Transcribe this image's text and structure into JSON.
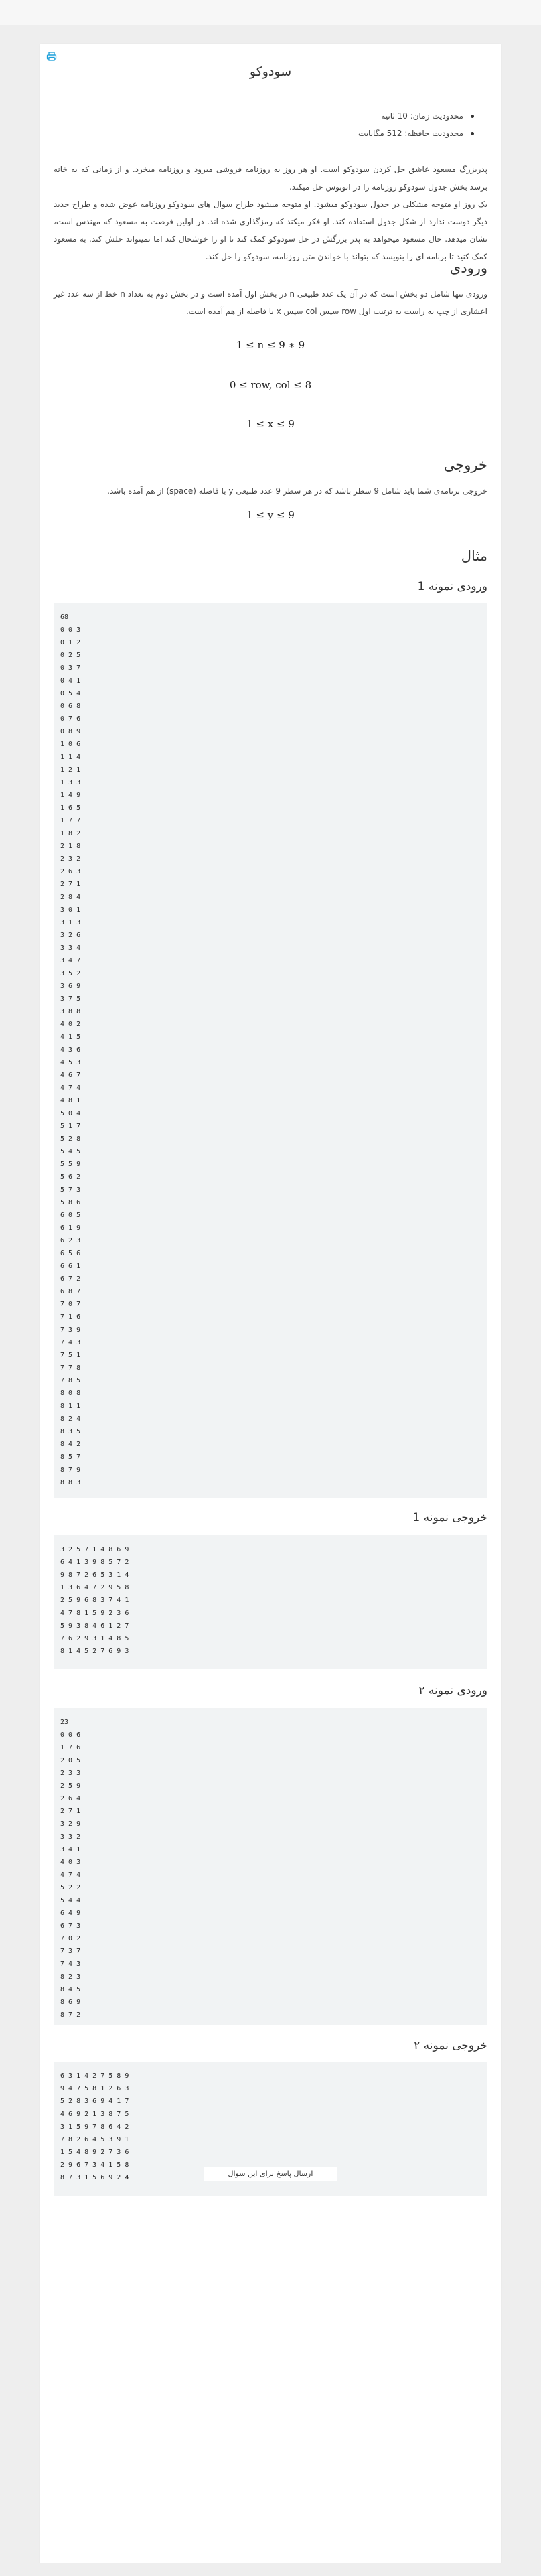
{
  "problem": {
    "title": "سودوکو",
    "limits": [
      "محدودیت زمان: 10 ثانیه",
      "محدودیت حافظه: 512 مگابایت"
    ],
    "statement": [
      "پدربزرگ مسعود عاشق حل کردن سودوکو است. او هر روز به روزنامه فروشی میرود و روزنامه میخرد. و از زمانی که به خانه برسد بخش جدول سودوکو روزنامه را در اتوبوس حل میکند.",
      "یک روز او متوجه مشکلی در جدول سودوکو میشود. او متوجه میشود طراح سوال های سودوکو روزنامه عوض شده و طراح جدید دیگر دوست ندارد از شکل جدول استفاده کند. او فکر میکند که رمزگذاری شده اند. در اولین فرصت به مسعود که مهندس است، نشان میدهد. حال مسعود میخواهد به پدر بزرگش در حل سودوکو کمک کند تا او را خوشحال کند اما نمیتواند حلش کند. به مسعود کمک کنید تا برنامه ای را بنویسد که بتواند با خواندن متن روزنامه، سودوکو را حل کند."
    ],
    "input_heading": "ورودی",
    "input_text": "ورودی تنها شامل دو بخش است که در آن یک عدد طبیعی n در بخش اول آمده است و در بخش دوم به تعداد n خط از سه عدد غیر اعشاری از چپ به راست به ترتیب اول row سپس col سپس x با فاصله از هم آمده است.",
    "input_math": [
      "1 ≤ n ≤ 9 ∗ 9",
      "0 ≤ row, col ≤ 8",
      "1 ≤ x ≤ 9"
    ],
    "output_heading": "خروجی",
    "output_text": "خروجی برنامه‌ی شما باید شامل 9 سطر باشد که در هر سطر 9 عدد طبیعی y با فاصله (space) از هم آمده باشد.",
    "output_math": "1 ≤ y ≤ 9",
    "example_heading": "مثال",
    "samples": [
      {
        "heading": "ورودی نمونه 1",
        "lines": [
          "68",
          "0 0 3",
          "0 1 2",
          "0 2 5",
          "0 3 7",
          "0 4 1",
          "0 5 4",
          "0 6 8",
          "0 7 6",
          "0 8 9",
          "1 0 6",
          "1 1 4",
          "1 2 1",
          "1 3 3",
          "1 4 9",
          "1 6 5",
          "1 7 7",
          "1 8 2",
          "2 1 8",
          "2 3 2",
          "2 6 3",
          "2 7 1",
          "2 8 4",
          "3 0 1",
          "3 1 3",
          "3 2 6",
          "3 3 4",
          "3 4 7",
          "3 5 2",
          "3 6 9",
          "3 7 5",
          "3 8 8",
          "4 0 2",
          "4 1 5",
          "4 3 6",
          "4 5 3",
          "4 6 7",
          "4 7 4",
          "4 8 1",
          "5 0 4",
          "5 1 7",
          "5 2 8",
          "5 4 5",
          "5 5 9",
          "5 6 2",
          "5 7 3",
          "5 8 6",
          "6 0 5",
          "6 1 9",
          "6 2 3",
          "6 5 6",
          "6 6 1",
          "6 7 2",
          "6 8 7",
          "7 0 7",
          "7 1 6",
          "7 3 9",
          "7 4 3",
          "7 5 1",
          "7 7 8",
          "7 8 5",
          "8 0 8",
          "8 1 1",
          "8 2 4",
          "8 3 5",
          "8 4 2",
          "8 5 7",
          "8 7 9",
          "8 8 3"
        ]
      },
      {
        "heading": "خروجی نمونه 1",
        "lines": [
          "3 2 5 7 1 4 8 6 9",
          "6 4 1 3 9 8 5 7 2",
          "9 8 7 2 6 5 3 1 4",
          "1 3 6 4 7 2 9 5 8",
          "2 5 9 6 8 3 7 4 1",
          "4 7 8 1 5 9 2 3 6",
          "5 9 3 8 4 6 1 2 7",
          "7 6 2 9 3 1 4 8 5",
          "8 1 4 5 2 7 6 9 3"
        ]
      },
      {
        "heading": "ورودی نمونه ۲",
        "lines": [
          "23",
          "0 0 6",
          "1 7 6",
          "2 0 5",
          "2 3 3",
          "2 5 9",
          "2 6 4",
          "2 7 1",
          "3 2 9",
          "3 3 2",
          "3 4 1",
          "4 0 3",
          "4 7 4",
          "5 2 2",
          "5 4 4",
          "6 4 9",
          "6 7 3",
          "7 0 2",
          "7 3 7",
          "7 4 3",
          "8 2 3",
          "8 4 5",
          "8 6 9",
          "8 7 2"
        ]
      },
      {
        "heading": "خروجی نمونه ۲",
        "lines": [
          "6 3 1 4 2 7 5 8 9",
          "9 4 7 5 8 1 2 6 3",
          "5 2 8 3 6 9 4 1 7",
          "4 6 9 2 1 3 8 7 5",
          "3 1 5 9 7 8 6 4 2",
          "7 8 2 6 4 5 3 9 1",
          "1 5 4 8 9 2 7 3 6",
          "2 9 6 7 3 4 1 5 8",
          "8 7 3 1 5 6 9 2 4"
        ]
      }
    ],
    "submit_label": "ارسال پاسخ برای این سوال"
  },
  "colors": {
    "accent": "#1a9fd9",
    "code_bg": "#f1f3f4"
  },
  "icons": {
    "print": "printer-icon"
  }
}
